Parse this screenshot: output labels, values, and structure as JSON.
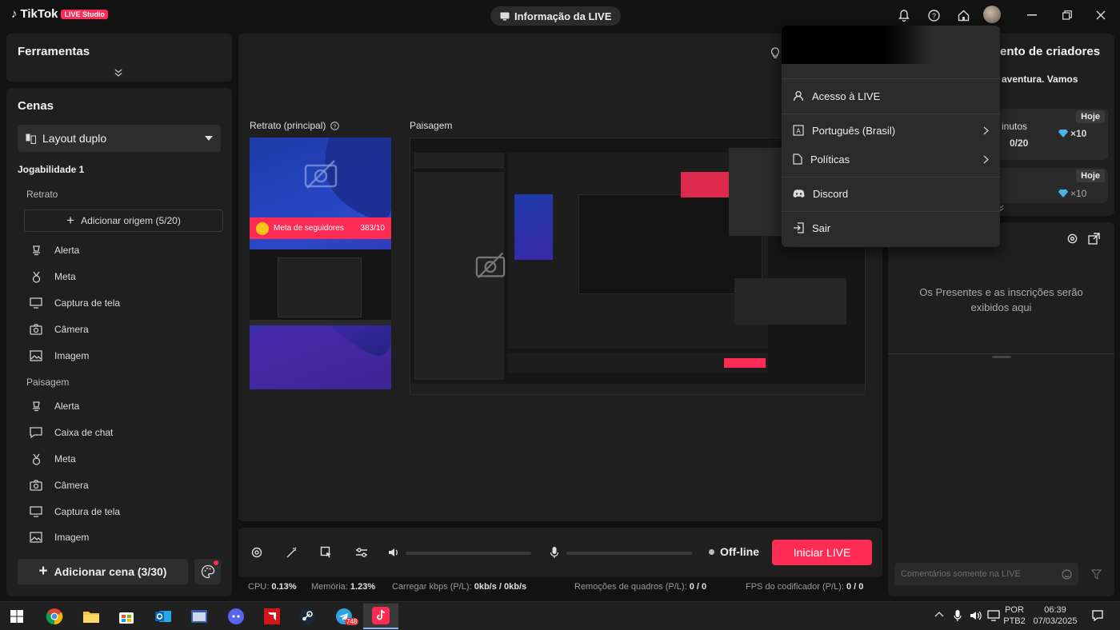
{
  "app": {
    "logo_text": "TikTok",
    "badge": "LIVE Studio",
    "live_info": "Informação da LIVE"
  },
  "tools": {
    "title": "Ferramentas"
  },
  "scenes": {
    "title": "Cenas",
    "layout_selected": "Layout duplo",
    "group_title": "Jogabilidade 1",
    "portrait_label": "Retrato",
    "add_source": "Adicionar origem (5/20)",
    "portrait_items": [
      "Alerta",
      "Meta",
      "Captura de tela",
      "Câmera",
      "Imagem"
    ],
    "landscape_label": "Paisagem",
    "landscape_items": [
      "Alerta",
      "Caixa de chat",
      "Meta",
      "Câmera",
      "Captura de tela",
      "Imagem"
    ],
    "add_scene": "Adicionar cena (3/30)"
  },
  "preview": {
    "portrait_label": "Retrato (principal)",
    "landscape_label": "Paisagem",
    "goal_label": "Meta de seguidores",
    "goal_value": "383/10"
  },
  "controls": {
    "status": "Off-line",
    "start_button": "Iniciar LIVE"
  },
  "stats": {
    "cpu_label": "CPU:",
    "cpu_value": "0.13%",
    "mem_label": "Memória:",
    "mem_value": "1.23%",
    "kbps_label": "Carregar kbps (P/L):",
    "kbps_value": "0kb/s / 0kb/s",
    "drops_label": "Remoções de quadros (P/L):",
    "drops_value": "0 / 0",
    "fps_label": "FPS do codificador (P/L):",
    "fps_value": "0 / 0"
  },
  "right": {
    "header_partial": "ento de criadores",
    "sub_partial": "aventura. Vamos",
    "card1_today": "Hoje",
    "card1_minutes": "inutos",
    "card1_progress": "0/20",
    "card1_multiplier": "×10",
    "card2_today": "Hoje",
    "card2_multiplier": "×10",
    "gifts_msg": "Os Presentes e as inscrições serão exibidos aqui",
    "comment_placeholder": "Comentários somente na LIVE"
  },
  "menu": {
    "items": [
      "Acesso à LIVE",
      "Português (Brasil)",
      "Políticas",
      "Discord",
      "Sair"
    ]
  },
  "taskbar": {
    "telegram_badge": "748",
    "lang_top": "POR",
    "lang_bottom": "PTB2",
    "time": "06:39",
    "date": "07/03/2025"
  },
  "colors": {
    "accent": "#fe2c55",
    "panel": "#1f1f1f",
    "background": "#121212"
  }
}
